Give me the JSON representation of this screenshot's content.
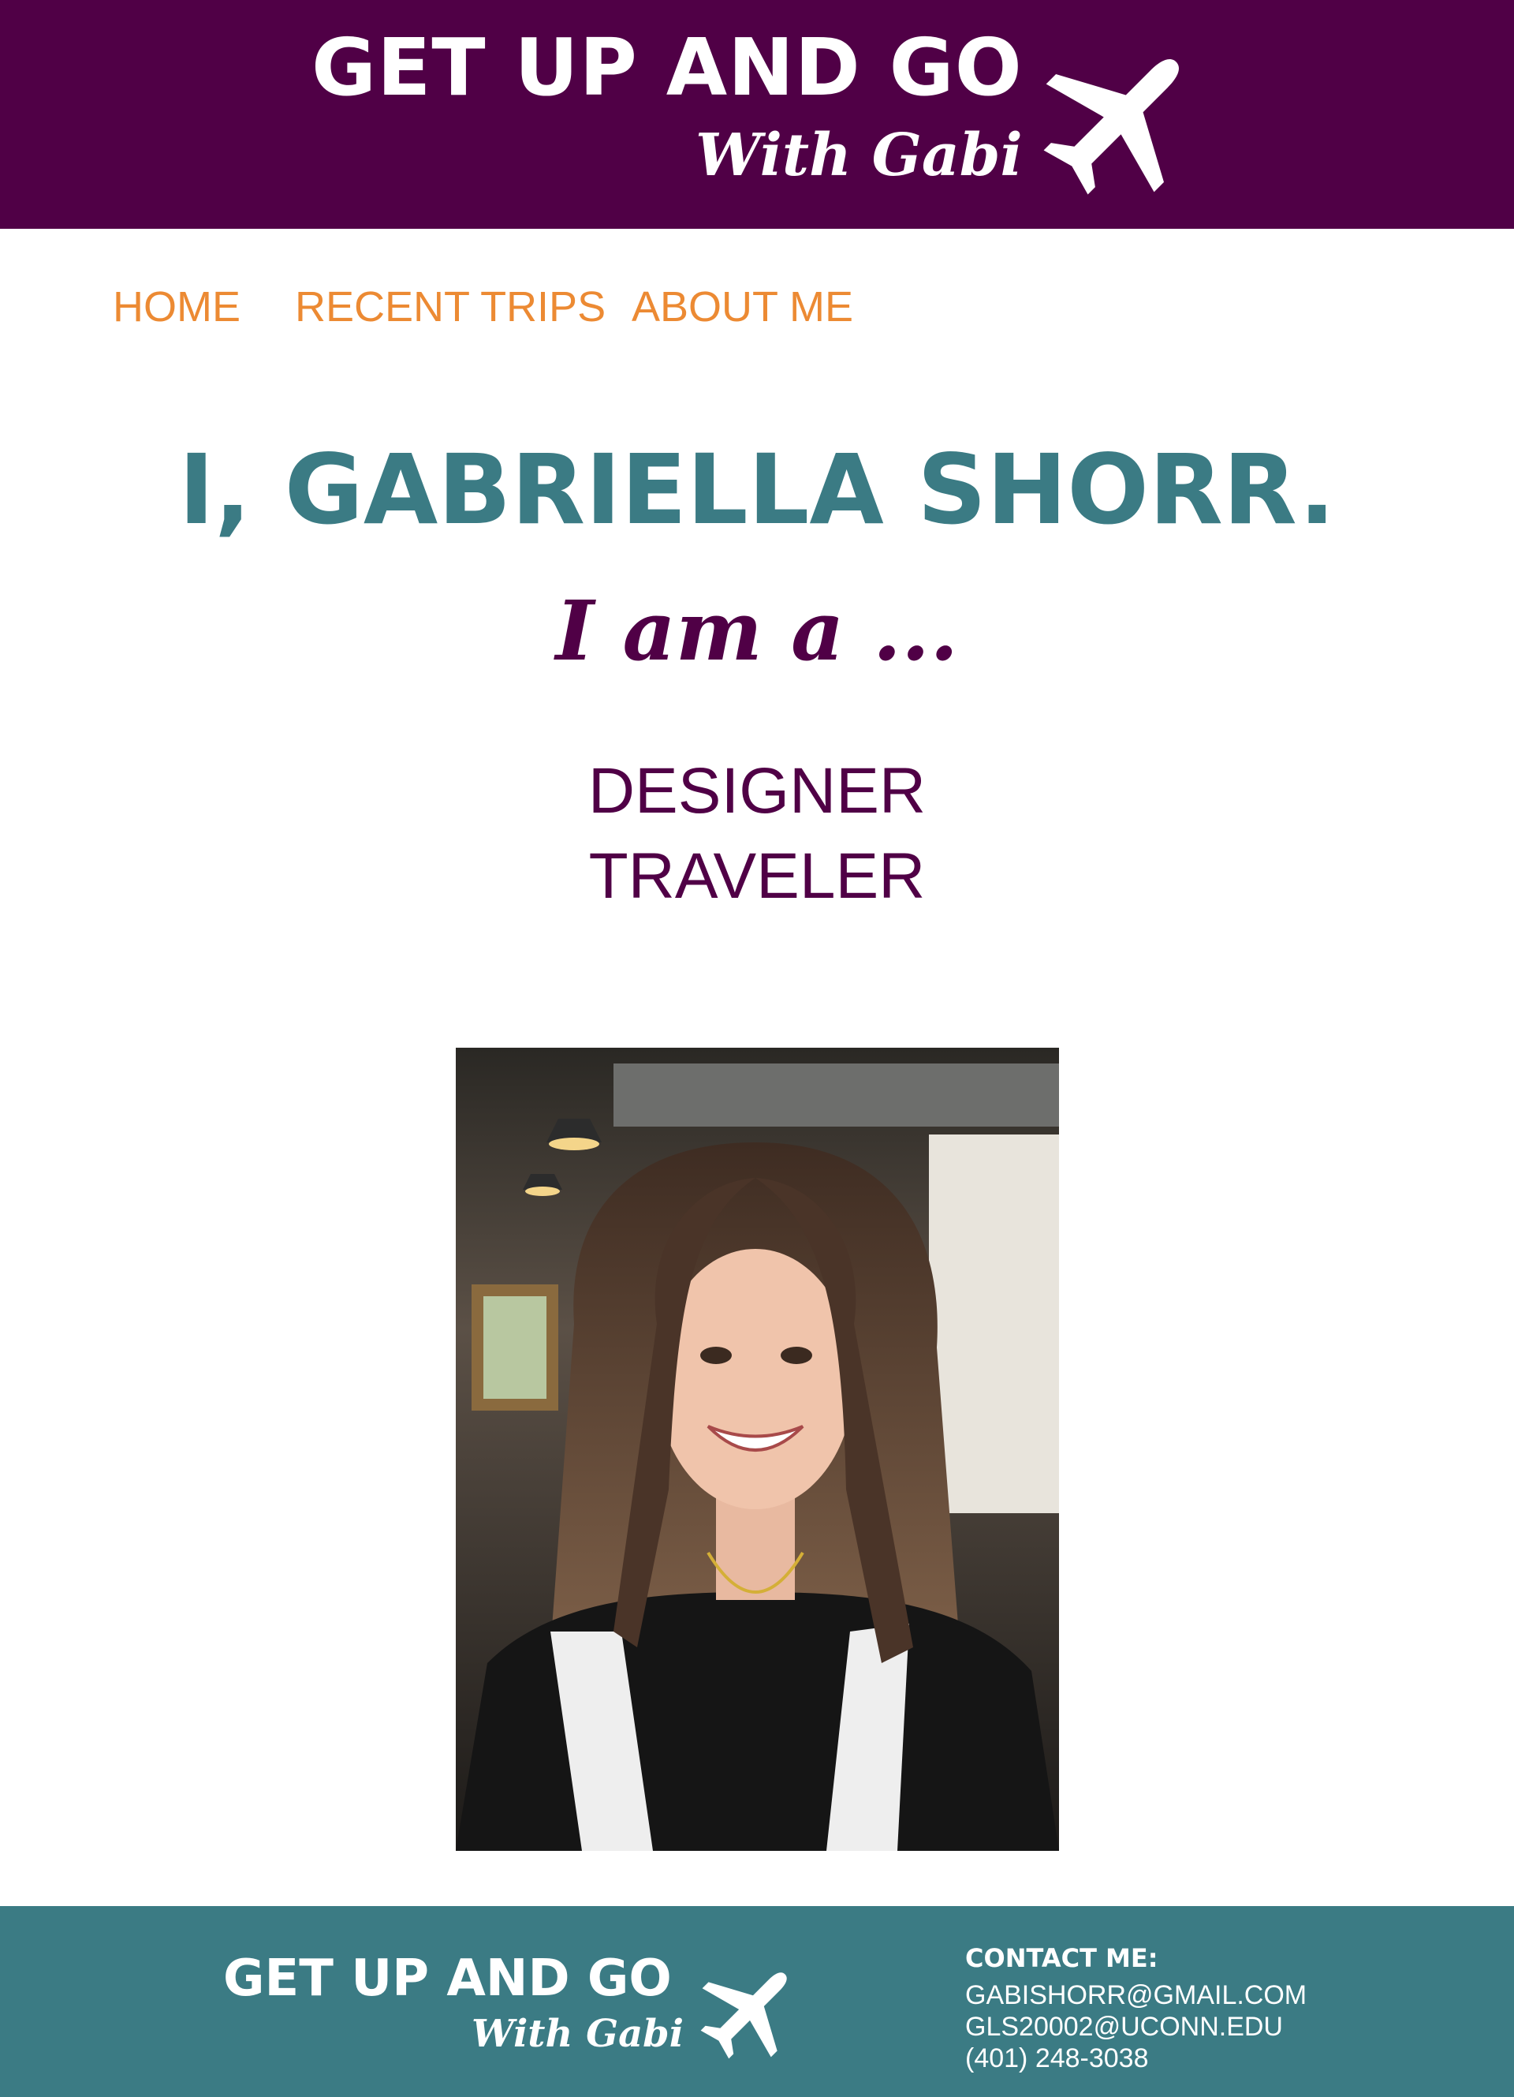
{
  "header": {
    "title": "GET UP AND GO",
    "subtitle": "With Gabi",
    "logo_icon": "airplane-icon",
    "background": "#500046"
  },
  "nav": {
    "items": [
      {
        "label": "HOME"
      },
      {
        "label": "RECENT TRIPS"
      },
      {
        "label": "ABOUT ME"
      }
    ],
    "color": "#ec8a33"
  },
  "hero": {
    "title": "I, GABRIELLA SHORR.",
    "subtitle": "I am a ...",
    "roles": [
      "DESIGNER",
      "TRAVELER"
    ],
    "title_color": "#3b7b84",
    "accent_color": "#500046"
  },
  "photo": {
    "alt": "selfie-portrait"
  },
  "footer": {
    "title": "GET UP AND GO",
    "subtitle": "With Gabi",
    "logo_icon": "airplane-icon",
    "contact_heading": "CONTACT ME:",
    "contacts": [
      "GABISHORR@GMAIL.COM",
      "GLS20002@UCONN.EDU",
      "(401) 248-3038"
    ],
    "background": "#3b7b84"
  }
}
